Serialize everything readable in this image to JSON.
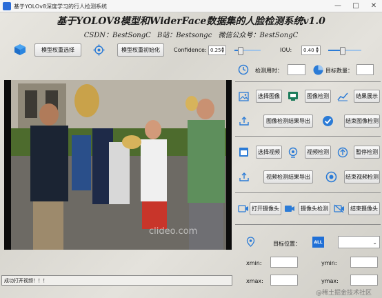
{
  "window": {
    "title": "基于YOLOv8深度学习的行人检测系统",
    "buttons": [
      "minimize",
      "maximize",
      "close"
    ]
  },
  "header": {
    "title": "基于YOLOV8模型和WiderFace数据集的人脸检测系统v1.0",
    "subtitle": "CSDN：BestSongC  B站：Bestsongc  微信公众号：BestSongC"
  },
  "toolbar": {
    "model_select_label": "模型权重选择",
    "model_init_label": "模型权重初始化",
    "confidence_label": "Confidence:",
    "confidence_value": "0.25",
    "confidence_level": 0.15,
    "iou_label": "IOU:",
    "iou_value": "0.40",
    "iou_level": 0.4
  },
  "stats": {
    "time_label": "检测用时：",
    "time_value": "",
    "count_label": "目标数量：",
    "count_value": ""
  },
  "image_section": {
    "select_image": "选择图像",
    "detect_image": "图像检测",
    "show_results": "结果展示",
    "export_image_results": "图像检测结果导出",
    "end_image_detect": "结束图像检测"
  },
  "video_section": {
    "select_video": "选择视频",
    "detect_video": "视频检测",
    "pause_detect": "暂停检测",
    "export_video_results": "视频检测结果导出",
    "end_video_detect": "结束视频检测"
  },
  "camera_section": {
    "open_camera": "打开摄像头",
    "camera_detect": "摄像头检测",
    "end_camera": "结束摄像头"
  },
  "target": {
    "position_label": "目标位置：",
    "all_badge": "ALL",
    "select_value": "",
    "xmin_label": "xmin:",
    "ymin_label": "ymin:",
    "xmax_label": "xmax:",
    "ymax_label": "ymax:"
  },
  "status": {
    "message": "成功打开视频！！！"
  },
  "watermarks": {
    "video_watermark": "clideo.com",
    "corner_watermark": "@稀土掘金技术社区"
  },
  "colors": {
    "accent": "#2b7bd6",
    "button_bg": "#e6e6e6",
    "panel_black": "#0c0c0c"
  }
}
